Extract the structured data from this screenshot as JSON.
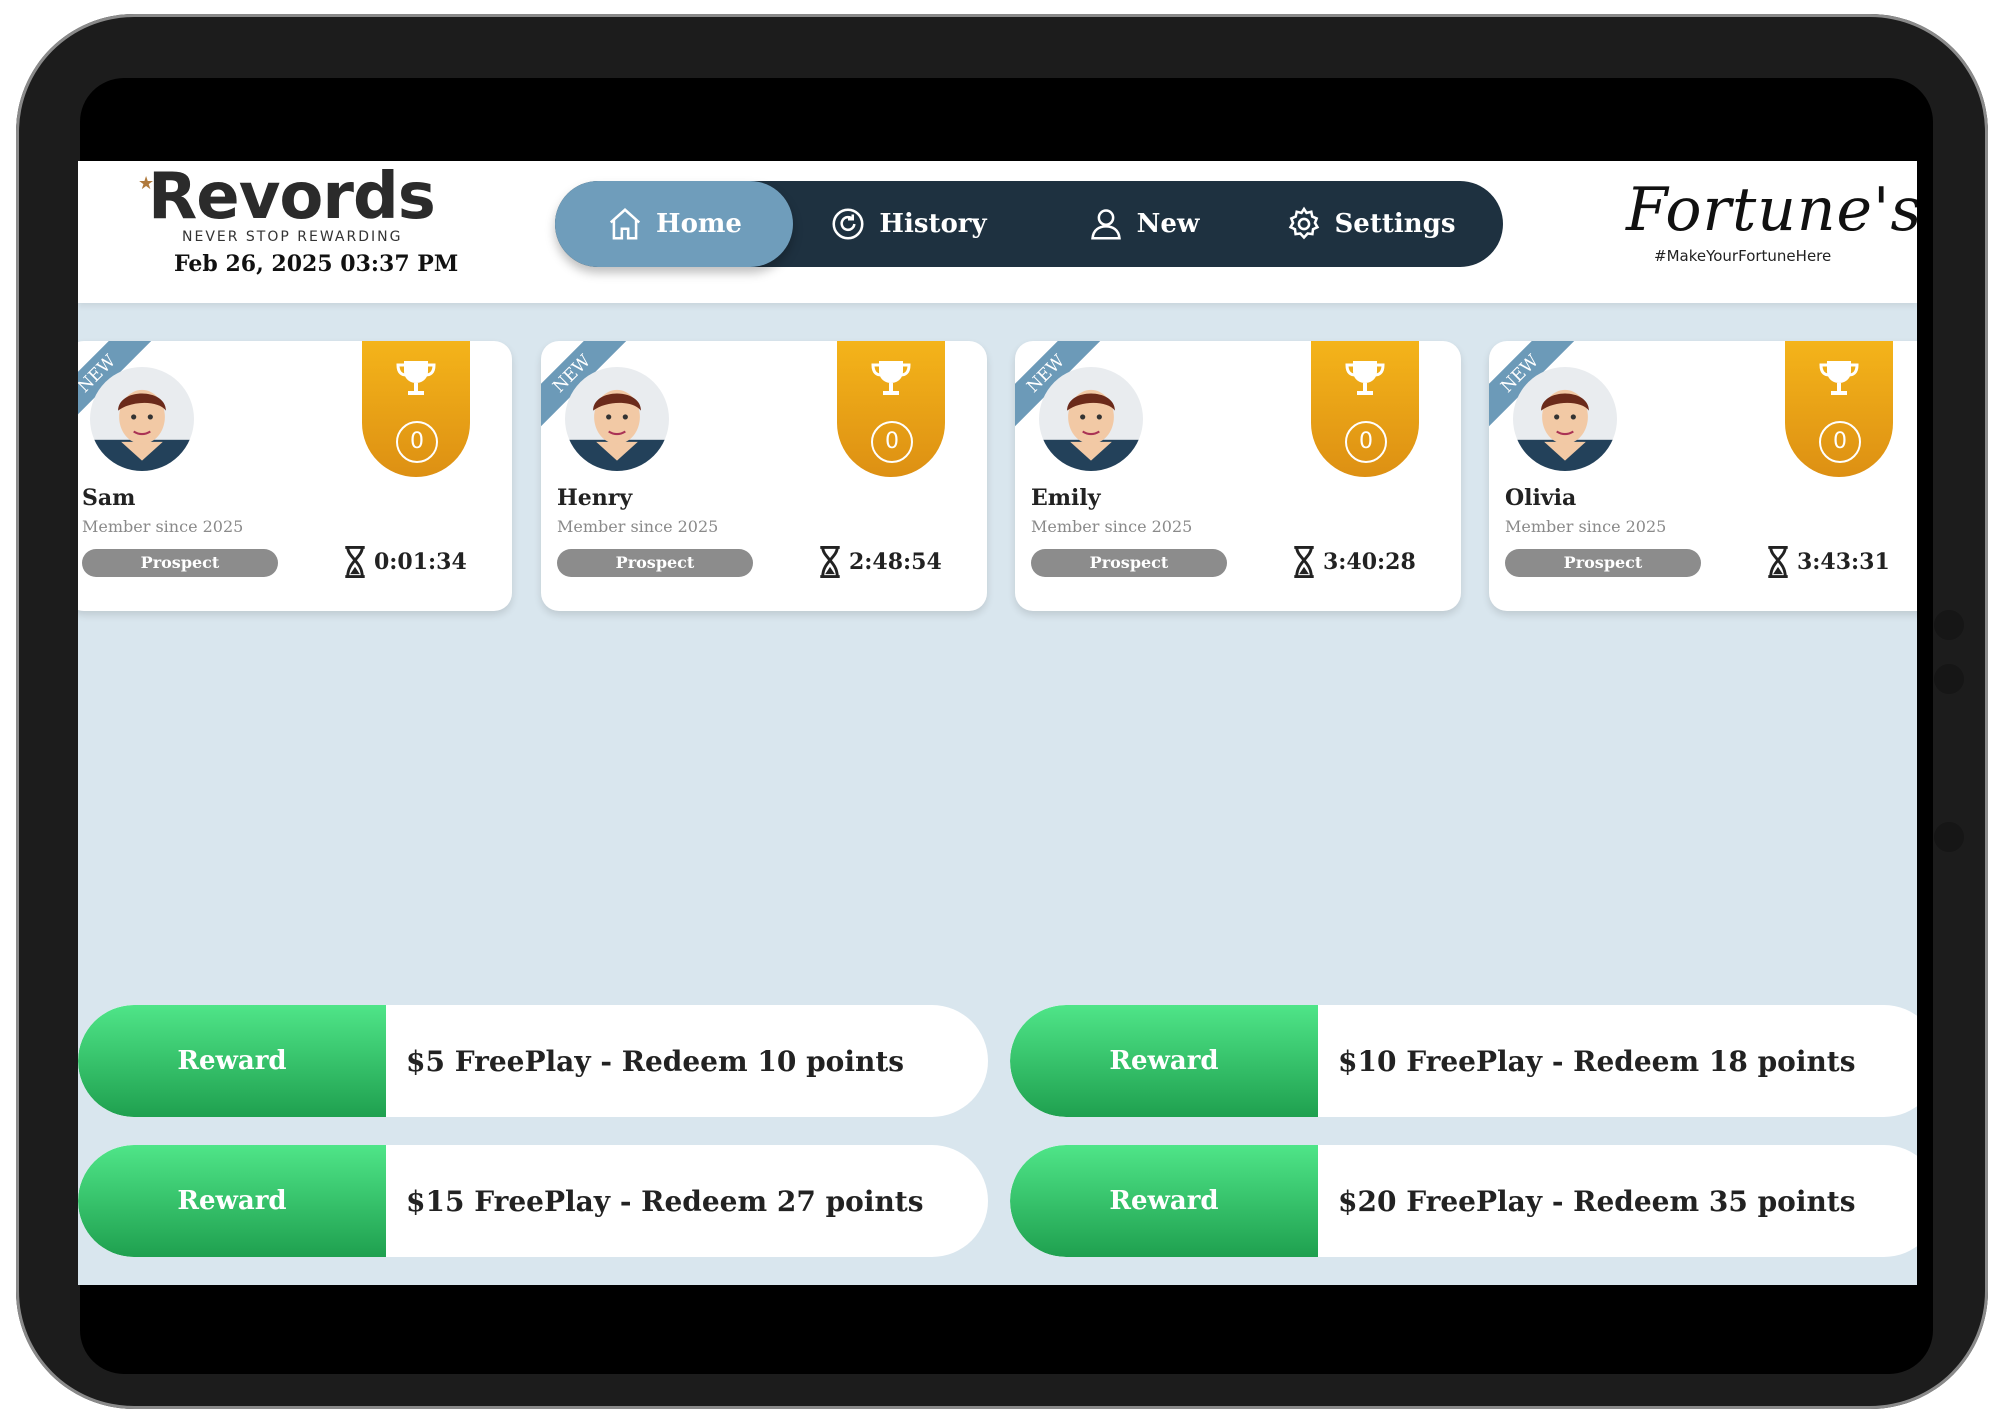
{
  "header": {
    "logo_word": "Revords",
    "logo_tagline": "NEVER STOP REWARDING",
    "datetime": "Feb 26, 2025 03:37 PM",
    "brand_word": "Fortune's",
    "brand_tagline": "#MakeYourFortuneHere"
  },
  "nav": {
    "home": "Home",
    "history": "History",
    "new": "New",
    "settings": "Settings"
  },
  "cards": [
    {
      "ribbon": "NEW",
      "name": "Sam",
      "member": "Member since 2025",
      "status": "Prospect",
      "timer": "0:01:34",
      "points": "0"
    },
    {
      "ribbon": "NEW",
      "name": "Henry",
      "member": "Member since 2025",
      "status": "Prospect",
      "timer": "2:48:54",
      "points": "0"
    },
    {
      "ribbon": "NEW",
      "name": "Emily",
      "member": "Member since 2025",
      "status": "Prospect",
      "timer": "3:40:28",
      "points": "0"
    },
    {
      "ribbon": "NEW",
      "name": "Olivia",
      "member": "Member since 2025",
      "status": "Prospect",
      "timer": "3:43:31",
      "points": "0"
    }
  ],
  "rewards": [
    {
      "button": "Reward",
      "text": "$5 FreePlay - Redeem 10 points"
    },
    {
      "button": "Reward",
      "text": "$10 FreePlay - Redeem 18 points"
    },
    {
      "button": "Reward",
      "text": "$15 FreePlay - Redeem 27 points"
    },
    {
      "button": "Reward",
      "text": "$20 FreePlay - Redeem 35 points"
    }
  ],
  "colors": {
    "nav_bg": "#1e3140",
    "nav_active": "#6f9dbb",
    "trophy": "#f0a91a",
    "reward_green": "#2dbb62",
    "status_badge": "#8c8c8c"
  }
}
